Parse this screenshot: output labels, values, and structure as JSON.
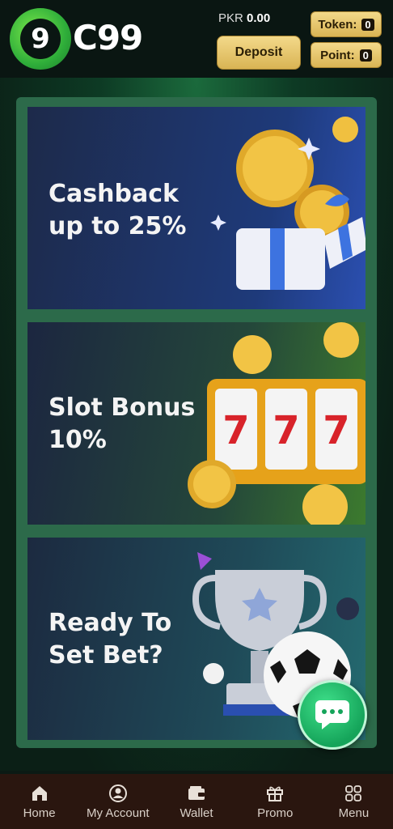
{
  "header": {
    "logo_number": "9",
    "logo_text": "C99",
    "balance_currency": "PKR",
    "balance_amount": "0.00",
    "deposit_label": "Deposit",
    "token_label": "Token:",
    "token_value": "0",
    "point_label": "Point:",
    "point_value": "0"
  },
  "promos": [
    {
      "title_line1": "Cashback",
      "title_line2": "up to 25%"
    },
    {
      "title_line1": "Slot Bonus",
      "title_line2": "10%"
    },
    {
      "title_line1": "Ready To",
      "title_line2": "Set Bet?"
    }
  ],
  "slot_symbols": [
    "7",
    "7",
    "7"
  ],
  "chat": {
    "icon": "chat-bubble-icon"
  },
  "bottom_nav": [
    {
      "label": "Home",
      "icon": "home-icon"
    },
    {
      "label": "My Account",
      "icon": "account-icon"
    },
    {
      "label": "Wallet",
      "icon": "wallet-icon"
    },
    {
      "label": "Promo",
      "icon": "gift-icon"
    },
    {
      "label": "Menu",
      "icon": "grid-menu-icon"
    }
  ],
  "colors": {
    "accent_gold": "#d9b454",
    "brand_green": "#2fae3a",
    "nav_bg": "#2a160f",
    "chat_green": "#15a45a"
  }
}
